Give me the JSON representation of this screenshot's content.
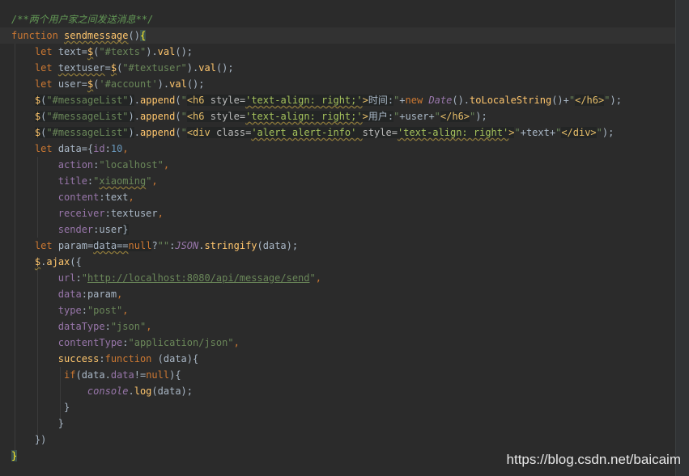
{
  "editor": {
    "lines": [
      [
        {
          "t": "/**两个用户家之间发送消息**/",
          "c": "cmt"
        }
      ],
      [
        {
          "t": "function ",
          "c": "kw"
        },
        {
          "t": "sendmessage",
          "c": "fn squiggle"
        },
        {
          "t": "()",
          "c": "plain"
        },
        {
          "t": "{",
          "c": "match"
        }
      ],
      [
        {
          "t": "    "
        },
        {
          "t": "let ",
          "c": "kw"
        },
        {
          "t": "text",
          "c": "plain"
        },
        {
          "t": "=",
          "c": "plain"
        },
        {
          "t": "$",
          "c": "fn squiggle"
        },
        {
          "t": "(",
          "c": "plain"
        },
        {
          "t": "\"#texts\"",
          "c": "str"
        },
        {
          "t": ").",
          "c": "plain"
        },
        {
          "t": "val",
          "c": "fn"
        },
        {
          "t": "();",
          "c": "plain"
        }
      ],
      [
        {
          "t": "    "
        },
        {
          "t": "let ",
          "c": "kw"
        },
        {
          "t": "textuser",
          "c": "plain squiggle"
        },
        {
          "t": "=",
          "c": "plain"
        },
        {
          "t": "$",
          "c": "fn squiggle"
        },
        {
          "t": "(",
          "c": "plain"
        },
        {
          "t": "\"#textuser\"",
          "c": "str"
        },
        {
          "t": ").",
          "c": "plain"
        },
        {
          "t": "val",
          "c": "fn"
        },
        {
          "t": "();",
          "c": "plain"
        }
      ],
      [
        {
          "t": "    "
        },
        {
          "t": "let ",
          "c": "kw"
        },
        {
          "t": "user",
          "c": "plain"
        },
        {
          "t": "=",
          "c": "plain"
        },
        {
          "t": "$",
          "c": "fn squiggle"
        },
        {
          "t": "(",
          "c": "plain"
        },
        {
          "t": "'#account'",
          "c": "str"
        },
        {
          "t": ").",
          "c": "plain"
        },
        {
          "t": "val",
          "c": "fn"
        },
        {
          "t": "();",
          "c": "plain"
        }
      ],
      [
        {
          "t": "    "
        },
        {
          "t": "$",
          "c": "fn strsel"
        },
        {
          "t": "(",
          "c": "plain strsel"
        },
        {
          "t": "\"#messageList\"",
          "c": "str strsel"
        },
        {
          "t": ")",
          "c": "plain strsel"
        },
        {
          "t": ".",
          "c": "plain"
        },
        {
          "t": "append",
          "c": "fn"
        },
        {
          "t": "(",
          "c": "plain"
        },
        {
          "t": "\"",
          "c": "str"
        },
        {
          "t": "<h6 ",
          "c": "tag strsel"
        },
        {
          "t": "style=",
          "c": "htmlattr strsel"
        },
        {
          "t": "'text-align: right;'",
          "c": "htmlval strsel squiggle"
        },
        {
          "t": ">",
          "c": "tag strsel"
        },
        {
          "t": "时间:",
          "c": "plain strsel"
        },
        {
          "t": "\"",
          "c": "str"
        },
        {
          "t": "+",
          "c": "plain"
        },
        {
          "t": "new ",
          "c": "kw"
        },
        {
          "t": "Date",
          "c": "cls"
        },
        {
          "t": "().",
          "c": "plain"
        },
        {
          "t": "toLocaleString",
          "c": "fn"
        },
        {
          "t": "()+",
          "c": "plain"
        },
        {
          "t": "\"",
          "c": "str"
        },
        {
          "t": "</h6>",
          "c": "tag strsel"
        },
        {
          "t": "\"",
          "c": "str"
        },
        {
          "t": ");",
          "c": "plain"
        }
      ],
      [
        {
          "t": "    "
        },
        {
          "t": "$",
          "c": "fn strsel"
        },
        {
          "t": "(",
          "c": "plain strsel"
        },
        {
          "t": "\"#messageList\"",
          "c": "str strsel"
        },
        {
          "t": ")",
          "c": "plain strsel"
        },
        {
          "t": ".",
          "c": "plain"
        },
        {
          "t": "append",
          "c": "fn"
        },
        {
          "t": "(",
          "c": "plain"
        },
        {
          "t": "\"",
          "c": "str"
        },
        {
          "t": "<h6 ",
          "c": "tag strsel"
        },
        {
          "t": "style=",
          "c": "htmlattr strsel"
        },
        {
          "t": "'text-align: right;'",
          "c": "htmlval strsel squiggle"
        },
        {
          "t": ">",
          "c": "tag strsel"
        },
        {
          "t": "用户:",
          "c": "plain strsel"
        },
        {
          "t": "\"",
          "c": "str"
        },
        {
          "t": "+",
          "c": "plain"
        },
        {
          "t": "user",
          "c": "plain"
        },
        {
          "t": "+",
          "c": "plain"
        },
        {
          "t": "\"",
          "c": "str"
        },
        {
          "t": "</h6>",
          "c": "tag strsel"
        },
        {
          "t": "\"",
          "c": "str"
        },
        {
          "t": ");",
          "c": "plain"
        }
      ],
      [
        {
          "t": "    "
        },
        {
          "t": "$",
          "c": "fn strsel"
        },
        {
          "t": "(",
          "c": "plain strsel"
        },
        {
          "t": "\"#messageList\"",
          "c": "str strsel"
        },
        {
          "t": ")",
          "c": "plain strsel"
        },
        {
          "t": ".",
          "c": "plain"
        },
        {
          "t": "append",
          "c": "fn"
        },
        {
          "t": "(",
          "c": "plain"
        },
        {
          "t": "\"",
          "c": "str"
        },
        {
          "t": "<div ",
          "c": "tag strsel"
        },
        {
          "t": "class=",
          "c": "htmlattr strsel"
        },
        {
          "t": "'alert alert-info' ",
          "c": "htmlval strsel squiggle"
        },
        {
          "t": "style=",
          "c": "htmlattr strsel"
        },
        {
          "t": "'text-align: right'",
          "c": "htmlval strsel squiggle"
        },
        {
          "t": ">",
          "c": "tag strsel"
        },
        {
          "t": "\"",
          "c": "str"
        },
        {
          "t": "+",
          "c": "plain"
        },
        {
          "t": "text",
          "c": "plain"
        },
        {
          "t": "+",
          "c": "plain"
        },
        {
          "t": "\"",
          "c": "str"
        },
        {
          "t": "</div>",
          "c": "tag strsel"
        },
        {
          "t": "\"",
          "c": "str"
        },
        {
          "t": ");",
          "c": "plain"
        }
      ],
      [
        {
          "t": "    "
        },
        {
          "t": "let ",
          "c": "kw"
        },
        {
          "t": "data",
          "c": "plain"
        },
        {
          "t": "={",
          "c": "plain"
        },
        {
          "t": "id",
          "c": "prop"
        },
        {
          "t": ":",
          "c": "plain"
        },
        {
          "t": "10",
          "c": "num"
        },
        {
          "t": ",",
          "c": "kw"
        }
      ],
      [
        {
          "t": "        "
        },
        {
          "t": "action",
          "c": "prop"
        },
        {
          "t": ":",
          "c": "plain"
        },
        {
          "t": "\"localhost\"",
          "c": "str"
        },
        {
          "t": ",",
          "c": "kw"
        }
      ],
      [
        {
          "t": "        "
        },
        {
          "t": "title",
          "c": "prop"
        },
        {
          "t": ":",
          "c": "plain"
        },
        {
          "t": "\"",
          "c": "str"
        },
        {
          "t": "xiaoming",
          "c": "str squiggle"
        },
        {
          "t": "\"",
          "c": "str"
        },
        {
          "t": ",",
          "c": "kw"
        }
      ],
      [
        {
          "t": "        "
        },
        {
          "t": "content",
          "c": "prop"
        },
        {
          "t": ":",
          "c": "plain"
        },
        {
          "t": "text",
          "c": "plain"
        },
        {
          "t": ",",
          "c": "kw"
        }
      ],
      [
        {
          "t": "        "
        },
        {
          "t": "receiver",
          "c": "prop"
        },
        {
          "t": ":",
          "c": "plain"
        },
        {
          "t": "textuser",
          "c": "plain"
        },
        {
          "t": ",",
          "c": "kw"
        }
      ],
      [
        {
          "t": "        "
        },
        {
          "t": "sender",
          "c": "prop"
        },
        {
          "t": ":",
          "c": "plain"
        },
        {
          "t": "user",
          "c": "plain"
        },
        {
          "t": "}",
          "c": "plain strsel"
        }
      ],
      [
        {
          "t": "    "
        },
        {
          "t": "let ",
          "c": "kw"
        },
        {
          "t": "param",
          "c": "plain"
        },
        {
          "t": "=",
          "c": "plain"
        },
        {
          "t": "data==",
          "c": "plain strsel squiggle"
        },
        {
          "t": "null",
          "c": "kw strsel"
        },
        {
          "t": "?",
          "c": "plain"
        },
        {
          "t": "\"\"",
          "c": "str"
        },
        {
          "t": ":",
          "c": "plain"
        },
        {
          "t": "JSON",
          "c": "obj"
        },
        {
          "t": ".",
          "c": "plain"
        },
        {
          "t": "stringify",
          "c": "fn"
        },
        {
          "t": "(data);",
          "c": "plain"
        }
      ],
      [
        {
          "t": "    "
        },
        {
          "t": "$",
          "c": "fn squiggle"
        },
        {
          "t": ".",
          "c": "plain"
        },
        {
          "t": "ajax",
          "c": "fn"
        },
        {
          "t": "({",
          "c": "plain"
        }
      ],
      [
        {
          "t": "        "
        },
        {
          "t": "url",
          "c": "prop"
        },
        {
          "t": ":",
          "c": "plain"
        },
        {
          "t": "\"",
          "c": "str"
        },
        {
          "t": "http://localhost:8080/api/message/send",
          "c": "str underline"
        },
        {
          "t": "\"",
          "c": "str"
        },
        {
          "t": ",",
          "c": "kw"
        }
      ],
      [
        {
          "t": "        "
        },
        {
          "t": "data",
          "c": "prop"
        },
        {
          "t": ":",
          "c": "plain"
        },
        {
          "t": "param",
          "c": "plain"
        },
        {
          "t": ",",
          "c": "kw"
        }
      ],
      [
        {
          "t": "        "
        },
        {
          "t": "type",
          "c": "prop"
        },
        {
          "t": ":",
          "c": "plain"
        },
        {
          "t": "\"post\"",
          "c": "str"
        },
        {
          "t": ",",
          "c": "kw"
        }
      ],
      [
        {
          "t": "        "
        },
        {
          "t": "dataType",
          "c": "prop"
        },
        {
          "t": ":",
          "c": "plain"
        },
        {
          "t": "\"json\"",
          "c": "str"
        },
        {
          "t": ",",
          "c": "kw"
        }
      ],
      [
        {
          "t": "        "
        },
        {
          "t": "contentType",
          "c": "prop"
        },
        {
          "t": ":",
          "c": "plain"
        },
        {
          "t": "\"application/json\"",
          "c": "str"
        },
        {
          "t": ",",
          "c": "kw"
        }
      ],
      [
        {
          "t": "        "
        },
        {
          "t": "success",
          "c": "fn"
        },
        {
          "t": ":",
          "c": "plain"
        },
        {
          "t": "function ",
          "c": "kw"
        },
        {
          "t": "(data){",
          "c": "plain"
        }
      ],
      [
        {
          "t": "         "
        },
        {
          "t": "if",
          "c": "kw"
        },
        {
          "t": "(data.",
          "c": "plain"
        },
        {
          "t": "data",
          "c": "prop"
        },
        {
          "t": "!=",
          "c": "plain"
        },
        {
          "t": "null",
          "c": "kw"
        },
        {
          "t": "){",
          "c": "plain"
        }
      ],
      [
        {
          "t": "             "
        },
        {
          "t": "console",
          "c": "obj"
        },
        {
          "t": ".",
          "c": "plain"
        },
        {
          "t": "log",
          "c": "fn"
        },
        {
          "t": "(data);",
          "c": "plain"
        }
      ],
      [
        {
          "t": "         "
        },
        {
          "t": "}",
          "c": "plain"
        }
      ],
      [
        {
          "t": "        "
        },
        {
          "t": "}",
          "c": "plain"
        }
      ],
      [
        {
          "t": "    "
        },
        {
          "t": "})",
          "c": "plain"
        }
      ],
      [
        {
          "t": "}",
          "c": "match"
        }
      ]
    ]
  },
  "watermark": "https://blog.csdn.net/baicaim"
}
